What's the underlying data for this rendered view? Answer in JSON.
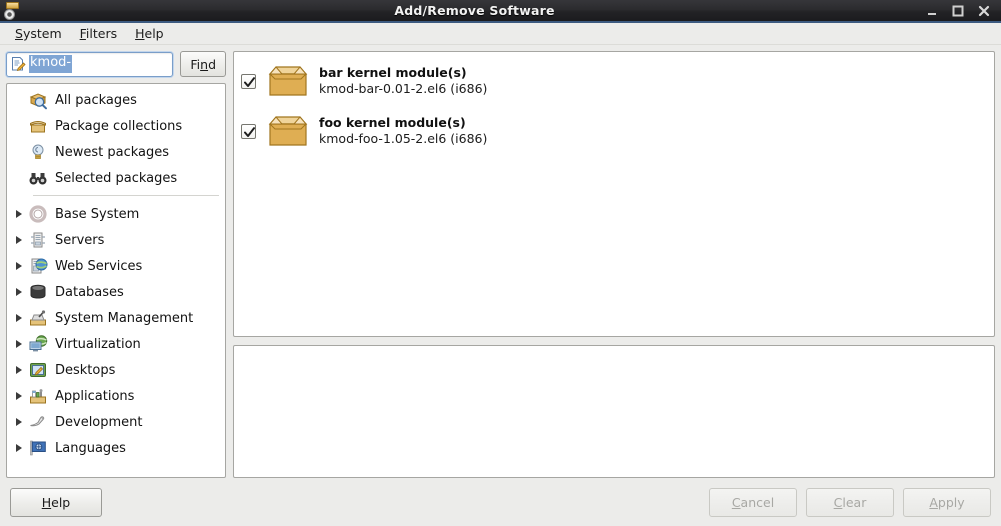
{
  "window": {
    "title": "Add/Remove Software",
    "icon": "package-disc-icon",
    "controls": [
      {
        "name": "minimize-button",
        "glyph": "minimize-icon"
      },
      {
        "name": "maximize-button",
        "glyph": "maximize-icon"
      },
      {
        "name": "close-button",
        "glyph": "close-icon"
      }
    ]
  },
  "menubar": {
    "items": [
      {
        "label": "System",
        "mnemonic": "S"
      },
      {
        "label": "Filters",
        "mnemonic": "F"
      },
      {
        "label": "Help",
        "mnemonic": "H"
      }
    ]
  },
  "search": {
    "icon": "search-document-icon",
    "value": "kmod-",
    "placeholder": "",
    "selected": true,
    "find_label_pre": "Fi",
    "find_label_mnemonic": "n",
    "find_label_post": "d",
    "find_label": "Find"
  },
  "sidebar": {
    "top_items": [
      {
        "label": "All packages",
        "icon": "all-packages-icon",
        "expandable": false
      },
      {
        "label": "Package collections",
        "icon": "package-collections-icon",
        "expandable": false
      },
      {
        "label": "Newest packages",
        "icon": "newest-packages-icon",
        "expandable": false
      },
      {
        "label": "Selected packages",
        "icon": "selected-packages-icon",
        "expandable": false
      }
    ],
    "group_items": [
      {
        "label": "Base System",
        "icon": "base-system-icon",
        "expandable": true
      },
      {
        "label": "Servers",
        "icon": "servers-icon",
        "expandable": true
      },
      {
        "label": "Web Services",
        "icon": "web-services-icon",
        "expandable": true
      },
      {
        "label": "Databases",
        "icon": "databases-icon",
        "expandable": true
      },
      {
        "label": "System Management",
        "icon": "system-management-icon",
        "expandable": true
      },
      {
        "label": "Virtualization",
        "icon": "virtualization-icon",
        "expandable": true
      },
      {
        "label": "Desktops",
        "icon": "desktops-icon",
        "expandable": true
      },
      {
        "label": "Applications",
        "icon": "applications-icon",
        "expandable": true
      },
      {
        "label": "Development",
        "icon": "development-icon",
        "expandable": true
      },
      {
        "label": "Languages",
        "icon": "languages-icon",
        "expandable": true
      }
    ]
  },
  "packages": [
    {
      "title": "bar kernel module(s)",
      "subtitle": "kmod-bar-0.01-2.el6 (i686)",
      "checked": true,
      "icon": "package-box-icon"
    },
    {
      "title": "foo kernel module(s)",
      "subtitle": "kmod-foo-1.05-2.el6 (i686)",
      "checked": true,
      "icon": "package-box-icon"
    }
  ],
  "details": {
    "text": ""
  },
  "footer": {
    "help_label": "Help",
    "help_mnemonic": "H",
    "cancel_label": "Cancel",
    "cancel_mnemonic": "C",
    "clear_label": "Clear",
    "clear_mnemonic": "C",
    "apply_label": "Apply",
    "apply_mnemonic": "A",
    "cancel_enabled": false,
    "clear_enabled": false,
    "apply_enabled": false
  },
  "colors": {
    "titlebar": "#2b2b2e",
    "accent_line": "#3c5a80",
    "window_bg": "#ececea",
    "selection_blue": "#7fa5d4",
    "panel_border": "#a6a6a2",
    "package_icon_gold": "#d8a23f"
  }
}
